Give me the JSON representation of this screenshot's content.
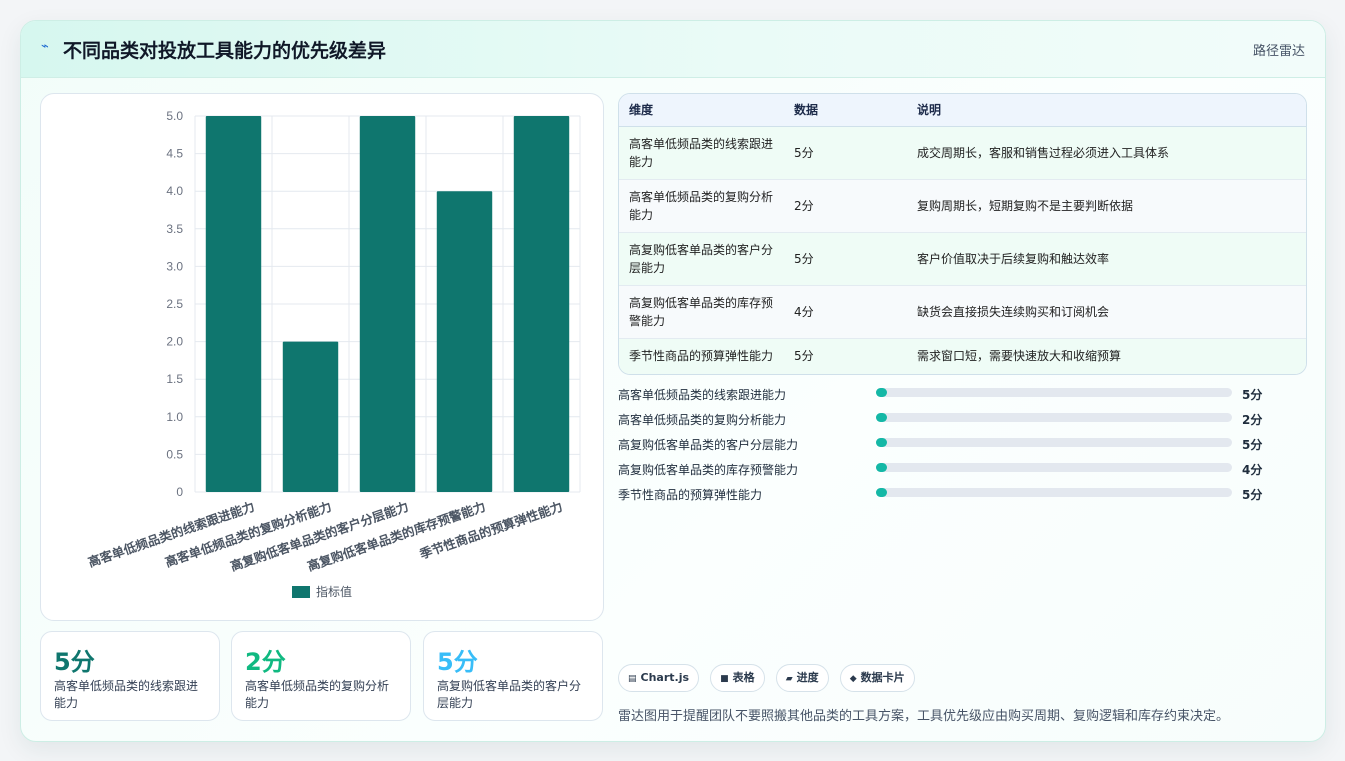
{
  "header": {
    "title": "不同品类对投放工具能力的优先级差异",
    "tag": "路径雷达"
  },
  "chart_data": {
    "type": "bar",
    "categories": [
      "高客单低频品类的线索跟进能力",
      "高客单低频品类的复购分析能力",
      "高复购低客单品类的客户分层能力",
      "高复购低客单品类的库存预警能力",
      "季节性商品的预算弹性能力"
    ],
    "series": [
      {
        "name": "指标值",
        "values": [
          5,
          2,
          5,
          4,
          5
        ]
      }
    ],
    "ylim": [
      0,
      5
    ],
    "yticks": [
      "0",
      "0.5",
      "1.0",
      "1.5",
      "2.0",
      "2.5",
      "3.0",
      "3.5",
      "4.0",
      "4.5",
      "5.0"
    ],
    "grid": true,
    "legend": "bottom",
    "color": "#0f766e"
  },
  "stats": [
    {
      "value": "5分",
      "label": "高客单低频品类的线索跟进能力",
      "color": "#0f766e"
    },
    {
      "value": "2分",
      "label": "高客单低频品类的复购分析能力",
      "color": "#10b981"
    },
    {
      "value": "5分",
      "label": "高复购低客单品类的客户分层能力",
      "color": "#38bdf8"
    }
  ],
  "table": {
    "headers": [
      "维度",
      "数据",
      "说明"
    ],
    "rows": [
      [
        "高客单低频品类的线索跟进能力",
        "5分",
        "成交周期长，客服和销售过程必须进入工具体系"
      ],
      [
        "高客单低频品类的复购分析能力",
        "2分",
        "复购周期长，短期复购不是主要判断依据"
      ],
      [
        "高复购低客单品类的客户分层能力",
        "5分",
        "客户价值取决于后续复购和触达效率"
      ],
      [
        "高复购低客单品类的库存预警能力",
        "4分",
        "缺货会直接损失连续购买和订阅机会"
      ],
      [
        "季节性商品的预算弹性能力",
        "5分",
        "需求窗口短，需要快速放大和收缩预算"
      ]
    ]
  },
  "progress": [
    {
      "label": "高客单低频品类的线索跟进能力",
      "value_text": "5分",
      "fraction": 0.03
    },
    {
      "label": "高客单低频品类的复购分析能力",
      "value_text": "2分",
      "fraction": 0.03
    },
    {
      "label": "高复购低客单品类的客户分层能力",
      "value_text": "5分",
      "fraction": 0.03
    },
    {
      "label": "高复购低客单品类的库存预警能力",
      "value_text": "4分",
      "fraction": 0.03
    },
    {
      "label": "季节性商品的预算弹性能力",
      "value_text": "5分",
      "fraction": 0.03
    }
  ],
  "pills": [
    {
      "icon": "chart-icon",
      "glyph": "▤",
      "label": "Chart.js"
    },
    {
      "icon": "table-icon",
      "glyph": "■",
      "label": "表格"
    },
    {
      "icon": "progress-icon",
      "glyph": "▰",
      "label": "进度"
    },
    {
      "icon": "card-icon",
      "glyph": "◆",
      "label": "数据卡片"
    }
  ],
  "note": "雷达图用于提醒团队不要照搬其他品类的工具方案，工具优先级应由购买周期、复购逻辑和库存约束决定。"
}
